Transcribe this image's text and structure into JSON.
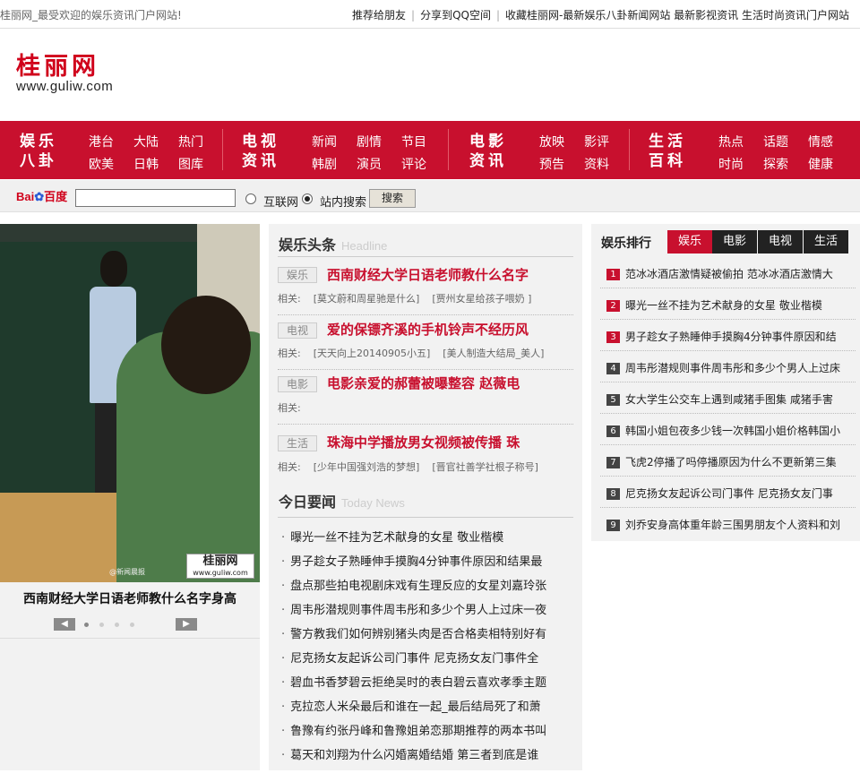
{
  "topbar": {
    "welcome": "桂丽网_最受欢迎的娱乐资讯门户网站!",
    "links": [
      "推荐给朋友",
      "分享到QQ空间",
      "收藏桂丽网-最新娱乐八卦新闻网站 最新影视资讯 生活时尚资讯门户网站"
    ]
  },
  "logo": {
    "cn": "桂丽网",
    "en": "www.guliw.com"
  },
  "nav": {
    "cats": [
      {
        "l1": "娱乐",
        "l2": "八卦",
        "links": [
          "港台",
          "大陆",
          "热门",
          "欧美",
          "日韩",
          "图库"
        ]
      },
      {
        "l1": "电视",
        "l2": "资讯",
        "links": [
          "新闻",
          "剧情",
          "节目",
          "韩剧",
          "演员",
          "评论"
        ]
      },
      {
        "l1": "电影",
        "l2": "资讯",
        "links": [
          "放映",
          "影评",
          "预告",
          "资料"
        ]
      },
      {
        "l1": "生活",
        "l2": "百科",
        "links": [
          "热点",
          "话题",
          "情感",
          "时尚",
          "探索",
          "健康"
        ]
      }
    ]
  },
  "search": {
    "brand_a": "Bai",
    "brand_b": "百度",
    "option1": "互联网",
    "option2": "站内搜索",
    "button": "搜索"
  },
  "slideshow": {
    "caption": "西南财经大学日语老师教什么名字身高",
    "watermark_cn": "桂丽网",
    "watermark_en": "www.guliw.com",
    "source": "@新闻晨报",
    "prev": "◀",
    "next": "▶"
  },
  "headline": {
    "title": "娱乐头条",
    "sub": "Headline",
    "items": [
      {
        "tag": "娱乐",
        "title": "西南财经大学日语老师教什么名字",
        "rel_label": "相关:",
        "rel": [
          "[莫文蔚和周星驰是什么]",
          "[贾州女星给孩子喂奶 ]"
        ]
      },
      {
        "tag": "电视",
        "title": "爱的保镖齐溪的手机铃声不经历风",
        "rel_label": "相关:",
        "rel": [
          "[天天向上20140905小五]",
          "[美人制造大结局_美人]"
        ]
      },
      {
        "tag": "电影",
        "title": "电影亲爱的郝蕾被曝整容 赵薇电",
        "rel_label": "相关:",
        "rel": []
      },
      {
        "tag": "生活",
        "title": "珠海中学播放男女视频被传播 珠",
        "rel_label": "相关:",
        "rel": [
          "[少年中国强刘浩的梦想]",
          "[晋官社善学社根子称号]"
        ]
      }
    ]
  },
  "today": {
    "title": "今日要闻",
    "sub": "Today News",
    "items": [
      "曝光一丝不挂为艺术献身的女星 敬业楷模",
      "男子趁女子熟睡伸手摸胸4分钟事件原因和结果最",
      "盘点那些拍电视剧床戏有生理反应的女星刘嘉玲张",
      "周韦彤潜规则事件周韦彤和多少个男人上过床一夜",
      "警方教我们如何辨别猪头肉是否合格卖相特别好有",
      "尼克扬女友起诉公司门事件 尼克扬女友门事件全",
      "碧血书香梦碧云拒绝吴时的表白碧云喜欢孝季主题",
      "克拉恋人米朵最后和谁在一起_最后结局死了和萧",
      "鲁豫有约张丹峰和鲁豫姐弟恋那期推荐的两本书叫",
      "葛天和刘翔为什么闪婚离婚结婚 第三者到底是谁"
    ]
  },
  "ranking": {
    "title": "娱乐排行",
    "tabs": [
      "娱乐",
      "电影",
      "电视",
      "生活"
    ],
    "items": [
      "范冰冰酒店激情疑被偷拍 范冰冰酒店激情大",
      "曝光一丝不挂为艺术献身的女星 敬业楷模",
      "男子趁女子熟睡伸手摸胸4分钟事件原因和结",
      "周韦彤潜规则事件周韦彤和多少个男人上过床",
      "女大学生公交车上遇到咸猪手图集 咸猪手害",
      "韩国小姐包夜多少钱一次韩国小姐价格韩国小",
      "飞虎2停播了吗停播原因为什么不更新第三集",
      "尼克扬女友起诉公司门事件 尼克扬女友门事",
      "刘乔安身高体重年龄三围男朋友个人资料和刘"
    ]
  }
}
